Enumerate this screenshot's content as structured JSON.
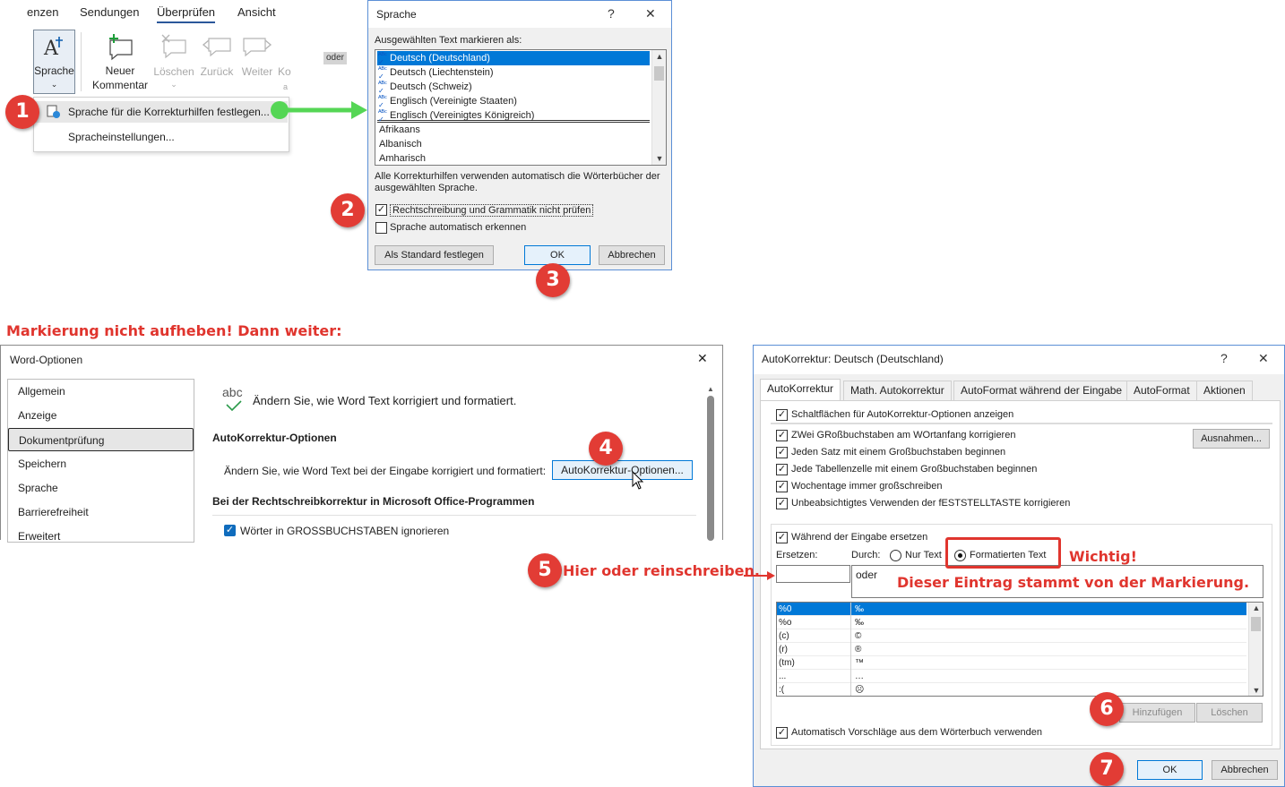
{
  "ribbon": {
    "tabs": [
      "enzen",
      "Sendungen",
      "Überprüfen",
      "Ansicht"
    ],
    "buttons": {
      "sprache": "Sprache",
      "neuer_kommentar_1": "Neuer",
      "neuer_kommentar_2": "Kommentar",
      "loeschen": "Löschen",
      "zurueck": "Zurück",
      "weiter": "Weiter",
      "ko": "Ko"
    },
    "oder_chip": "oder",
    "menu": {
      "item1": "Sprache für die Korrekturhilfen festlegen...",
      "item2": "Spracheinstellungen..."
    }
  },
  "badges": [
    "1",
    "2",
    "3",
    "4",
    "5",
    "6",
    "7"
  ],
  "annotations": {
    "markierung": "Markierung nicht aufheben! Dann weiter:",
    "hier_oder": "Hier oder reinschreiben.",
    "wichtig": "Wichtig!",
    "dieser_eintrag": "Dieser Eintrag stammt von der Markierung."
  },
  "sprache_dialog": {
    "title": "Sprache",
    "help": "?",
    "close": "✕",
    "list_label": "Ausgewählten Text markieren als:",
    "languages": [
      {
        "name": "Deutsch (Deutschland)",
        "selected": true,
        "spell": true
      },
      {
        "name": "Deutsch (Liechtenstein)",
        "selected": false,
        "spell": true
      },
      {
        "name": "Deutsch (Schweiz)",
        "selected": false,
        "spell": true
      },
      {
        "name": "Englisch (Vereinigte Staaten)",
        "selected": false,
        "spell": true
      },
      {
        "name": "Englisch (Vereinigtes Königreich)",
        "selected": false,
        "spell": true
      },
      {
        "name": "Afrikaans",
        "selected": false,
        "spell": false
      },
      {
        "name": "Albanisch",
        "selected": false,
        "spell": false
      },
      {
        "name": "Amharisch",
        "selected": false,
        "spell": false
      }
    ],
    "info": "Alle Korrekturhilfen verwenden automatisch die Wörterbücher der ausgewählten Sprache.",
    "check_no_spell": "Rechtschreibung und Grammatik nicht prüfen",
    "check_auto_detect": "Sprache automatisch erkennen",
    "btn_default": "Als Standard festlegen",
    "btn_ok": "OK",
    "btn_cancel": "Abbrechen"
  },
  "word_options": {
    "title": "Word-Optionen",
    "close": "✕",
    "nav": [
      "Allgemein",
      "Anzeige",
      "Dokumentprüfung",
      "Speichern",
      "Sprache",
      "Barrierefreiheit",
      "Erweitert"
    ],
    "abc": "abc",
    "header_text": "Ändern Sie, wie Word Text korrigiert und formatiert.",
    "section1": "AutoKorrektur-Optionen",
    "section1_desc": "Ändern Sie, wie Word Text bei der Eingabe korrigiert und formatiert:",
    "autokorrektur_btn": "AutoKorrektur-Optionen...",
    "section2": "Bei der Rechtschreibkorrektur in Microsoft Office-Programmen",
    "check_gross": "Wörter in GROSSBUCHSTABEN ignorieren"
  },
  "autokorrektur": {
    "title": "AutoKorrektur: Deutsch (Deutschland)",
    "help": "?",
    "close": "✕",
    "tabs": [
      "AutoKorrektur",
      "Math. Autokorrektur",
      "AutoFormat während der Eingabe",
      "AutoFormat",
      "Aktionen"
    ],
    "checks": [
      "Schaltflächen für AutoKorrektur-Optionen anzeigen",
      "ZWei GRoßbuchstaben am WOrtanfang korrigieren",
      "Jeden Satz mit einem Großbuchstaben beginnen",
      "Jede Tabellenzelle mit einem Großbuchstaben beginnen",
      "Wochentage immer großschreiben",
      "Unbeabsichtigtes Verwenden der fESTSTELLTASTE korrigieren"
    ],
    "btn_ausnahmen": "Ausnahmen...",
    "check_replace": "Während der Eingabe ersetzen",
    "label_ersetzen": "Ersetzen:",
    "label_durch": "Durch:",
    "radio_nur_text": "Nur Text",
    "radio_formatiert": "Formatierten Text",
    "ersetzen_value": "",
    "durch_value": "oder",
    "table": [
      [
        "%0",
        "‰"
      ],
      [
        "%o",
        "‰"
      ],
      [
        "(c)",
        "©"
      ],
      [
        "(r)",
        "®"
      ],
      [
        "(tm)",
        "™"
      ],
      [
        "...",
        "…"
      ],
      [
        ":(",
        "☹"
      ]
    ],
    "btn_hinzufuegen": "Hinzufügen",
    "btn_loeschen": "Löschen",
    "check_vorschlaege": "Automatisch Vorschläge aus dem Wörterbuch verwenden",
    "btn_ok": "OK",
    "btn_cancel": "Abbrechen"
  }
}
